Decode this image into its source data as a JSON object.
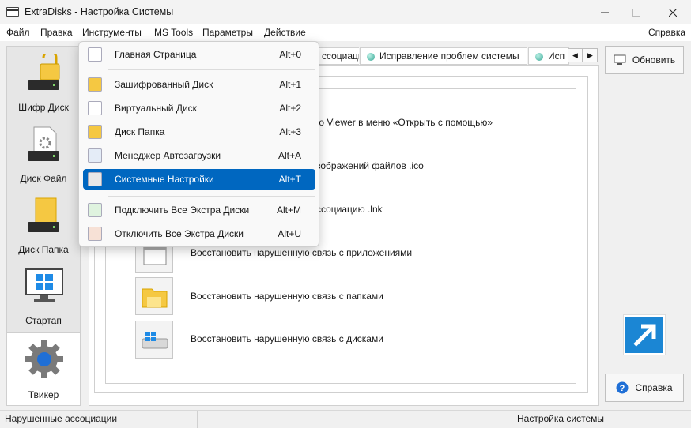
{
  "window": {
    "title": "ExtraDisks - Настройка Системы"
  },
  "menubar": {
    "items": [
      "Файл",
      "Правка",
      "Инструменты",
      "MS Tools",
      "Параметры",
      "Действие"
    ],
    "help": "Справка"
  },
  "sidebar": {
    "items": [
      {
        "label": "Шифр Диск",
        "icon": "encrypted-drive-icon"
      },
      {
        "label": "Диск Файл",
        "icon": "file-drive-icon"
      },
      {
        "label": "Диск Папка",
        "icon": "folder-drive-icon"
      },
      {
        "label": "Стартап",
        "icon": "startup-monitor-icon"
      },
      {
        "label": "Твикер",
        "icon": "gear-icon",
        "active": true
      }
    ]
  },
  "tabs": {
    "partial_left": "ссоциации",
    "fix": "Исправление проблем системы",
    "partial_right": "Исп",
    "prev": "◀",
    "next": "▶"
  },
  "content": {
    "rows": [
      {
        "text": "to Viewer в меню «Открыть с помощью»"
      },
      {
        "text": "зображений файлов .ico"
      },
      {
        "text": "ссоциацию .lnk"
      },
      {
        "text": "Восстановить нарушенную связь с приложениями"
      },
      {
        "text": "Восстановить нарушенную связь с папками"
      },
      {
        "text": "Восстановить нарушенную связь с дисками"
      }
    ]
  },
  "buttons": {
    "refresh": "Обновить",
    "help": "Справка"
  },
  "statusbar": {
    "left": "Нарушенные ассоциации",
    "right": "Настройка системы"
  },
  "dropdown": {
    "items": [
      {
        "label": "Главная Страница",
        "shortcut": "Alt+0",
        "icon": "home-page-icon"
      },
      {
        "label": "Зашифрованный Диск",
        "shortcut": "Alt+1",
        "icon": "encrypted-disk-icon"
      },
      {
        "label": "Виртуальный Диск",
        "shortcut": "Alt+2",
        "icon": "virtual-disk-icon"
      },
      {
        "label": "Диск Папка",
        "shortcut": "Alt+3",
        "icon": "folder-disk-icon"
      },
      {
        "label": "Менеджер Автозагрузки",
        "shortcut": "Alt+A",
        "icon": "startup-manager-icon"
      },
      {
        "label": "Системные Настройки",
        "shortcut": "Alt+T",
        "icon": "system-settings-icon",
        "highlighted": true
      },
      {
        "label": "Подключить Все Экстра Диски",
        "shortcut": "Alt+M",
        "icon": "mount-all-icon"
      },
      {
        "label": "Отключить Все Экстра Диски",
        "shortcut": "Alt+U",
        "icon": "unmount-all-icon"
      }
    ]
  },
  "colors": {
    "accent": "#0067c0",
    "tab_dot": "#3aa896",
    "arrow_tile": "#1b86d4",
    "folder": "#f5c842"
  }
}
